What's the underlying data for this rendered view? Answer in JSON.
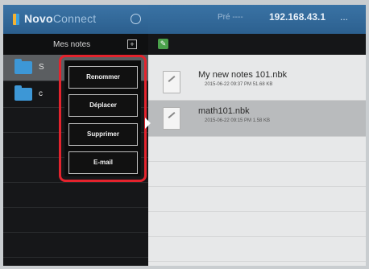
{
  "app": {
    "title_brand": "Novo",
    "title_rest": "Connect",
    "status_text": "Pré ----",
    "ip": "192.168.43.1",
    "more": "..."
  },
  "left_panel": {
    "title": "Mes notes",
    "add_label": "+",
    "folders": [
      {
        "label": "S",
        "selected": true
      },
      {
        "label": "c",
        "selected": false
      }
    ]
  },
  "right_panel": {
    "edit_label": "✎",
    "files": [
      {
        "name": "My new notes 101.nbk",
        "meta": "2015-06-22 09:37 PM   51.68 KB",
        "selected": false
      },
      {
        "name": "math101.nbk",
        "meta": "2015-06-22 09:15 PM   1.58 KB",
        "selected": true
      }
    ]
  },
  "context_menu": {
    "items": [
      "Renommer",
      "Déplacer",
      "Supprimer",
      "E-mail"
    ]
  },
  "colors": {
    "highlight": "#e4232d",
    "topbar": "#2f6696",
    "folder": "#3d97d6"
  }
}
